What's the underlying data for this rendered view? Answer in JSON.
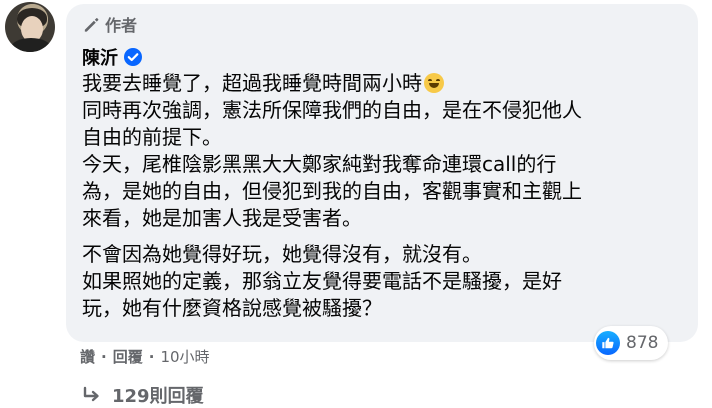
{
  "comment": {
    "author_badge": "作者",
    "author_name": "陳沂",
    "verified": true,
    "paragraphs": [
      [
        "我要去睡覺了，超過我睡覺時間兩小時"
      ],
      [
        "同時再次強調，憲法所保障我們的自由，是在不侵犯他人",
        "自由的前提下。"
      ],
      [
        "今天，尾椎陰影黑黑大大鄭家純對我奪命連環call的行",
        "為，是她的自由，但侵犯到我的自由，客觀事實和主觀上",
        "來看，她是加害人我是受害者。"
      ],
      [
        "不會因為她覺得好玩，她覺得沒有，就沒有。",
        "如果照她的定義，那翁立友覺得要電話不是騷擾，是好",
        "玩，她有什麼資格說感覺被騷擾？"
      ]
    ],
    "emoji": "grinning-squinting-face"
  },
  "reactions": {
    "type": "like",
    "count": "878"
  },
  "actions": {
    "like": "讚",
    "reply": "回覆",
    "time": "10小時"
  },
  "replies_link": "129則回覆",
  "colors": {
    "bubble": "#f0f2f5",
    "secondary_text": "#65676b",
    "link_blue": "#0866ff"
  }
}
